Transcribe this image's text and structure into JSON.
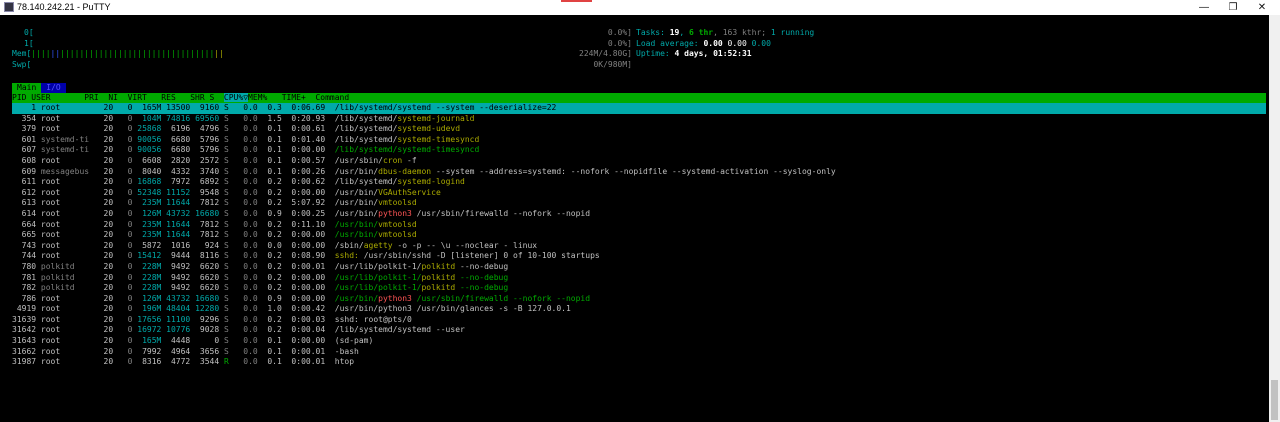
{
  "window": {
    "title": "78.140.242.21 - PuTTY",
    "controls": {
      "minimize": "—",
      "maximize": "❐",
      "close": "✕"
    }
  },
  "meters": {
    "cpu0": {
      "label": "0[",
      "value": "0.0%]"
    },
    "cpu1": {
      "label": "1[",
      "value": "0.0%]"
    },
    "mem": {
      "label": "Mem[",
      "value": "224M/4.80G]"
    },
    "swp": {
      "label": "Swp[",
      "value": "0K/980M]"
    }
  },
  "info": {
    "tasks": {
      "prefix": "Tasks: ",
      "count": "19",
      "sep": ", ",
      "thr": "6 thr",
      "rest": ", 163 kthr; ",
      "running": "1 running"
    },
    "load": {
      "prefix": "Load average: ",
      "a": "0.00",
      "b": "0.00",
      "c": "0.00"
    },
    "uptime": {
      "prefix": "Uptime: ",
      "value": "4 days, 01:52:31"
    }
  },
  "tabs": {
    "main": "Main",
    "io": "I/O"
  },
  "columns": "PID USER       PRI  NI  VIRT   RES   SHR S  CPU%▽MEM%   TIME+  Command",
  "processes": [
    {
      "pid": "1",
      "user": "root",
      "pri": "20",
      "ni": "0",
      "virt": "165M",
      "res": "13500",
      "shr": "9160",
      "s": "S",
      "cpu": "0.0",
      "mem": "0.3",
      "time": "0:06.69",
      "cmd": [
        {
          "t": "/lib/systemd/systemd --system --deserialize=22",
          "c": ""
        }
      ]
    },
    {
      "pid": "354",
      "user": "root",
      "pri": "20",
      "ni": "0",
      "virt": "104M",
      "res": "74816",
      "shr": "69560",
      "s": "S",
      "cpu": "0.0",
      "mem": "1.5",
      "time": "0:20.93",
      "cmd": [
        {
          "t": "/lib/systemd/",
          "c": ""
        },
        {
          "t": "systemd-journald",
          "c": "cmd-b"
        }
      ]
    },
    {
      "pid": "379",
      "user": "root",
      "pri": "20",
      "ni": "0",
      "virt": "25868",
      "res": "6196",
      "shr": "4796",
      "s": "S",
      "cpu": "0.0",
      "mem": "0.1",
      "time": "0:00.61",
      "cmd": [
        {
          "t": "/lib/systemd/",
          "c": ""
        },
        {
          "t": "systemd-udevd",
          "c": "cmd-b"
        }
      ]
    },
    {
      "pid": "601",
      "user": "systemd-ti",
      "pri": "20",
      "ni": "0",
      "virt": "90056",
      "res": "6680",
      "shr": "5796",
      "s": "S",
      "cpu": "0.0",
      "mem": "0.1",
      "time": "0:01.40",
      "cmd": [
        {
          "t": "/lib/systemd/",
          "c": ""
        },
        {
          "t": "systemd-timesyncd",
          "c": "cmd-b"
        }
      ]
    },
    {
      "pid": "607",
      "user": "systemd-ti",
      "pri": "20",
      "ni": "0",
      "virt": "90056",
      "res": "6680",
      "shr": "5796",
      "s": "S",
      "cpu": "0.0",
      "mem": "0.1",
      "time": "0:00.00",
      "cmd": [
        {
          "t": "/lib/systemd/",
          "c": "cmd-g"
        },
        {
          "t": "systemd-timesyncd",
          "c": "cmd-g"
        }
      ]
    },
    {
      "pid": "608",
      "user": "root",
      "pri": "20",
      "ni": "0",
      "virt": "6608",
      "res": "2820",
      "shr": "2572",
      "s": "S",
      "cpu": "0.0",
      "mem": "0.1",
      "time": "0:00.57",
      "cmd": [
        {
          "t": "/usr/sbin/",
          "c": ""
        },
        {
          "t": "cron",
          "c": "cmd-b"
        },
        {
          "t": " -f",
          "c": ""
        }
      ]
    },
    {
      "pid": "609",
      "user": "messagebus",
      "pri": "20",
      "ni": "0",
      "virt": "8040",
      "res": "4332",
      "shr": "3740",
      "s": "S",
      "cpu": "0.0",
      "mem": "0.1",
      "time": "0:00.26",
      "cmd": [
        {
          "t": "/usr/bin/",
          "c": ""
        },
        {
          "t": "dbus-daemon",
          "c": "cmd-b"
        },
        {
          "t": " --system --address=systemd: --nofork --nopidfile --systemd-activation --syslog-only",
          "c": ""
        }
      ]
    },
    {
      "pid": "611",
      "user": "root",
      "pri": "20",
      "ni": "0",
      "virt": "16868",
      "res": "7972",
      "shr": "6892",
      "s": "S",
      "cpu": "0.0",
      "mem": "0.2",
      "time": "0:00.62",
      "cmd": [
        {
          "t": "/lib/systemd/",
          "c": ""
        },
        {
          "t": "systemd-logind",
          "c": "cmd-b"
        }
      ]
    },
    {
      "pid": "612",
      "user": "root",
      "pri": "20",
      "ni": "0",
      "virt": "52348",
      "res": "11152",
      "shr": "9548",
      "s": "S",
      "cpu": "0.0",
      "mem": "0.2",
      "time": "0:00.00",
      "cmd": [
        {
          "t": "/usr/bin/",
          "c": ""
        },
        {
          "t": "VGAuthService",
          "c": "cmd-b"
        }
      ]
    },
    {
      "pid": "613",
      "user": "root",
      "pri": "20",
      "ni": "0",
      "virt": "235M",
      "res": "11644",
      "shr": "7812",
      "s": "S",
      "cpu": "0.0",
      "mem": "0.2",
      "time": "5:07.92",
      "cmd": [
        {
          "t": "/usr/bin/",
          "c": ""
        },
        {
          "t": "vmtoolsd",
          "c": "cmd-b"
        }
      ]
    },
    {
      "pid": "614",
      "user": "root",
      "pri": "20",
      "ni": "0",
      "virt": "126M",
      "res": "43732",
      "shr": "16680",
      "s": "S",
      "cpu": "0.0",
      "mem": "0.9",
      "time": "0:00.25",
      "cmd": [
        {
          "t": "/usr/bin/",
          "c": ""
        },
        {
          "t": "python3",
          "c": "cmd-r"
        },
        {
          "t": " /usr/sbin/firewalld --nofork --nopid",
          "c": ""
        }
      ]
    },
    {
      "pid": "664",
      "user": "root",
      "pri": "20",
      "ni": "0",
      "virt": "235M",
      "res": "11644",
      "shr": "7812",
      "s": "S",
      "cpu": "0.0",
      "mem": "0.2",
      "time": "0:11.10",
      "cmd": [
        {
          "t": "/usr/bin/",
          "c": "cmd-g"
        },
        {
          "t": "vmtoolsd",
          "c": "cmd-b"
        }
      ]
    },
    {
      "pid": "665",
      "user": "root",
      "pri": "20",
      "ni": "0",
      "virt": "235M",
      "res": "11644",
      "shr": "7812",
      "s": "S",
      "cpu": "0.0",
      "mem": "0.2",
      "time": "0:00.00",
      "cmd": [
        {
          "t": "/usr/bin/",
          "c": "cmd-g"
        },
        {
          "t": "vmtoolsd",
          "c": "cmd-b"
        }
      ]
    },
    {
      "pid": "743",
      "user": "root",
      "pri": "20",
      "ni": "0",
      "virt": "5872",
      "res": "1016",
      "shr": "924",
      "s": "S",
      "cpu": "0.0",
      "mem": "0.0",
      "time": "0:00.00",
      "cmd": [
        {
          "t": "/sbin/",
          "c": ""
        },
        {
          "t": "agetty",
          "c": "cmd-b"
        },
        {
          "t": " -o -p -- \\u --noclear - linux",
          "c": ""
        }
      ]
    },
    {
      "pid": "744",
      "user": "root",
      "pri": "20",
      "ni": "0",
      "virt": "15412",
      "res": "9444",
      "shr": "8116",
      "s": "S",
      "cpu": "0.0",
      "mem": "0.2",
      "time": "0:08.90",
      "cmd": [
        {
          "t": "sshd:",
          "c": "cmd-b"
        },
        {
          "t": " /usr/sbin/sshd -D [listener] 0 of 10-100 startups",
          "c": ""
        }
      ]
    },
    {
      "pid": "780",
      "user": "polkitd",
      "pri": "20",
      "ni": "0",
      "virt": "228M",
      "res": "9492",
      "shr": "6620",
      "s": "S",
      "cpu": "0.0",
      "mem": "0.2",
      "time": "0:00.01",
      "cmd": [
        {
          "t": "/usr/lib/polkit-1/",
          "c": ""
        },
        {
          "t": "polkitd",
          "c": "cmd-b"
        },
        {
          "t": " --no-debug",
          "c": ""
        }
      ]
    },
    {
      "pid": "781",
      "user": "polkitd",
      "pri": "20",
      "ni": "0",
      "virt": "228M",
      "res": "9492",
      "shr": "6620",
      "s": "S",
      "cpu": "0.0",
      "mem": "0.2",
      "time": "0:00.00",
      "cmd": [
        {
          "t": "/usr/lib/polkit-1/",
          "c": "cmd-g"
        },
        {
          "t": "polkitd",
          "c": "cmd-b"
        },
        {
          "t": " --no-debug",
          "c": "cmd-g"
        }
      ]
    },
    {
      "pid": "782",
      "user": "polkitd",
      "pri": "20",
      "ni": "0",
      "virt": "228M",
      "res": "9492",
      "shr": "6620",
      "s": "S",
      "cpu": "0.0",
      "mem": "0.2",
      "time": "0:00.00",
      "cmd": [
        {
          "t": "/usr/lib/polkit-1/",
          "c": "cmd-g"
        },
        {
          "t": "polkitd",
          "c": "cmd-b"
        },
        {
          "t": " --no-debug",
          "c": "cmd-g"
        }
      ]
    },
    {
      "pid": "786",
      "user": "root",
      "pri": "20",
      "ni": "0",
      "virt": "126M",
      "res": "43732",
      "shr": "16680",
      "s": "S",
      "cpu": "0.0",
      "mem": "0.9",
      "time": "0:00.00",
      "cmd": [
        {
          "t": "/usr/bin/",
          "c": "cmd-g"
        },
        {
          "t": "python3",
          "c": "cmd-r"
        },
        {
          "t": " /usr/sbin/firewalld --nofork --nopid",
          "c": "cmd-g"
        }
      ]
    },
    {
      "pid": "4919",
      "user": "root",
      "pri": "20",
      "ni": "0",
      "virt": "196M",
      "res": "48404",
      "shr": "12280",
      "s": "S",
      "cpu": "0.0",
      "mem": "1.0",
      "time": "0:00.42",
      "cmd": [
        {
          "t": "/usr/bin/python3 /usr/bin/glances -s -B 127.0.0.1",
          "c": ""
        }
      ]
    },
    {
      "pid": "31639",
      "user": "root",
      "pri": "20",
      "ni": "0",
      "virt": "17656",
      "res": "11100",
      "shr": "9296",
      "s": "S",
      "cpu": "0.0",
      "mem": "0.2",
      "time": "0:00.03",
      "cmd": [
        {
          "t": "sshd: root@pts/0",
          "c": ""
        }
      ]
    },
    {
      "pid": "31642",
      "user": "root",
      "pri": "20",
      "ni": "0",
      "virt": "16972",
      "res": "10776",
      "shr": "9028",
      "s": "S",
      "cpu": "0.0",
      "mem": "0.2",
      "time": "0:00.04",
      "cmd": [
        {
          "t": "/lib/systemd/systemd --user",
          "c": ""
        }
      ]
    },
    {
      "pid": "31643",
      "user": "root",
      "pri": "20",
      "ni": "0",
      "virt": "165M",
      "res": "4448",
      "shr": "0",
      "s": "S",
      "cpu": "0.0",
      "mem": "0.1",
      "time": "0:00.00",
      "cmd": [
        {
          "t": "(sd-pam)",
          "c": ""
        }
      ]
    },
    {
      "pid": "31662",
      "user": "root",
      "pri": "20",
      "ni": "0",
      "virt": "7992",
      "res": "4964",
      "shr": "3656",
      "s": "S",
      "cpu": "0.0",
      "mem": "0.1",
      "time": "0:00.01",
      "cmd": [
        {
          "t": "-bash",
          "c": ""
        }
      ]
    },
    {
      "pid": "31987",
      "user": "root",
      "pri": "20",
      "ni": "0",
      "virt": "8316",
      "res": "4772",
      "shr": "3544",
      "s": "R",
      "cpu": "0.0",
      "mem": "0.1",
      "time": "0:00.01",
      "cmd": [
        {
          "t": "htop",
          "c": ""
        }
      ]
    }
  ],
  "colors": {
    "header_bg": "#00aa00",
    "selected_bg": "#00aaaa",
    "accent": "#00aaaa",
    "basename": "#aaaa00",
    "thread": "#00aa00",
    "python": "#ff5555"
  }
}
